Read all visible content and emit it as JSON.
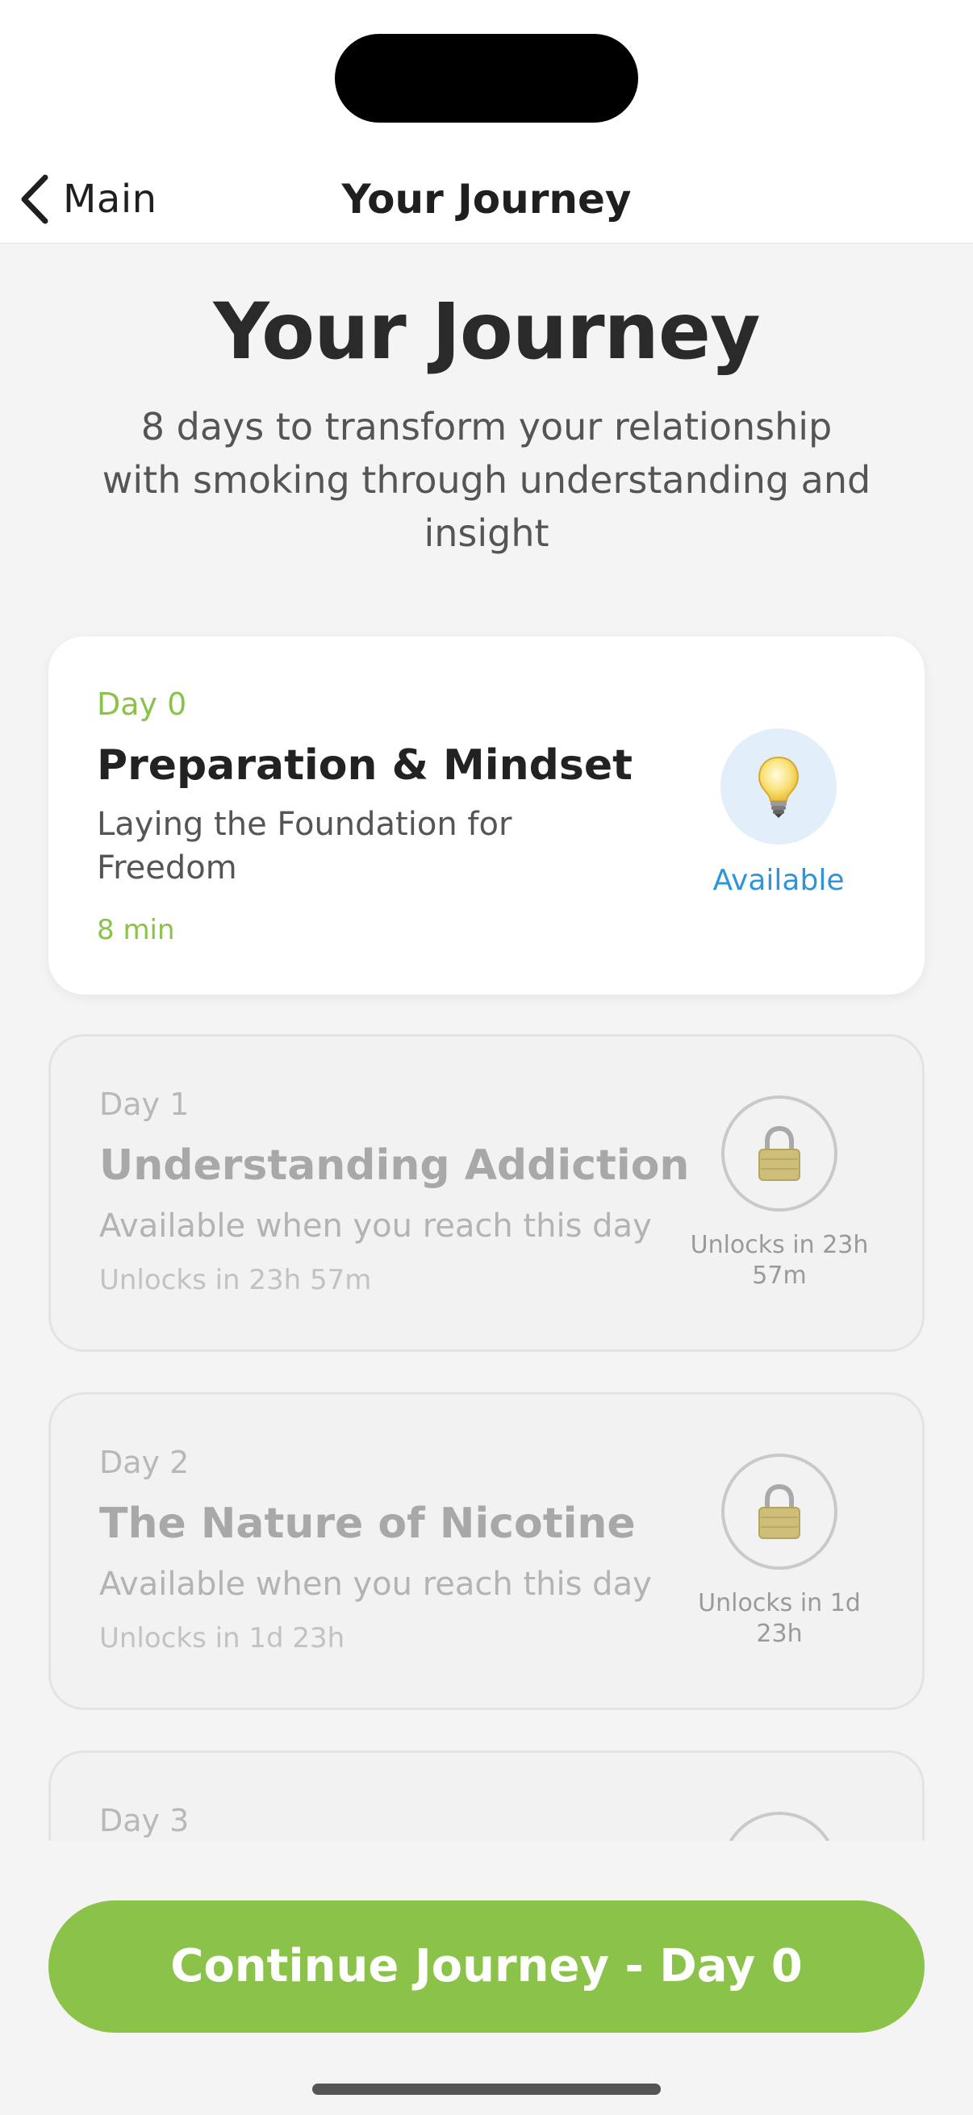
{
  "nav": {
    "back_label": "Main",
    "title": "Your Journey"
  },
  "header": {
    "title": "Your Journey",
    "subtitle": "8 days to transform your relationship with smoking through understanding and insight"
  },
  "days": [
    {
      "day": "Day 0",
      "title": "Preparation & Mindset",
      "description": "Laying the Foundation for Freedom",
      "meta": "8 min",
      "status": "Available",
      "icon": "lightbulb-icon"
    },
    {
      "day": "Day 1",
      "title": "Understanding Addiction",
      "description": "Available when you reach this day",
      "meta": "Unlocks in 23h 57m",
      "status": "Unlocks in 23h 57m",
      "icon": "lock-icon"
    },
    {
      "day": "Day 2",
      "title": "The Nature of Nicotine",
      "description": "Available when you reach this day",
      "meta": "Unlocks in 1d 23h",
      "status": "Unlocks in 1d 23h",
      "icon": "lock-icon"
    },
    {
      "day": "Day 3",
      "icon": "lock-icon"
    }
  ],
  "footer": {
    "continue_label": "Continue Journey - Day 0"
  },
  "colors": {
    "accent_green": "#8bc34a",
    "available_blue": "#2e95d9"
  }
}
